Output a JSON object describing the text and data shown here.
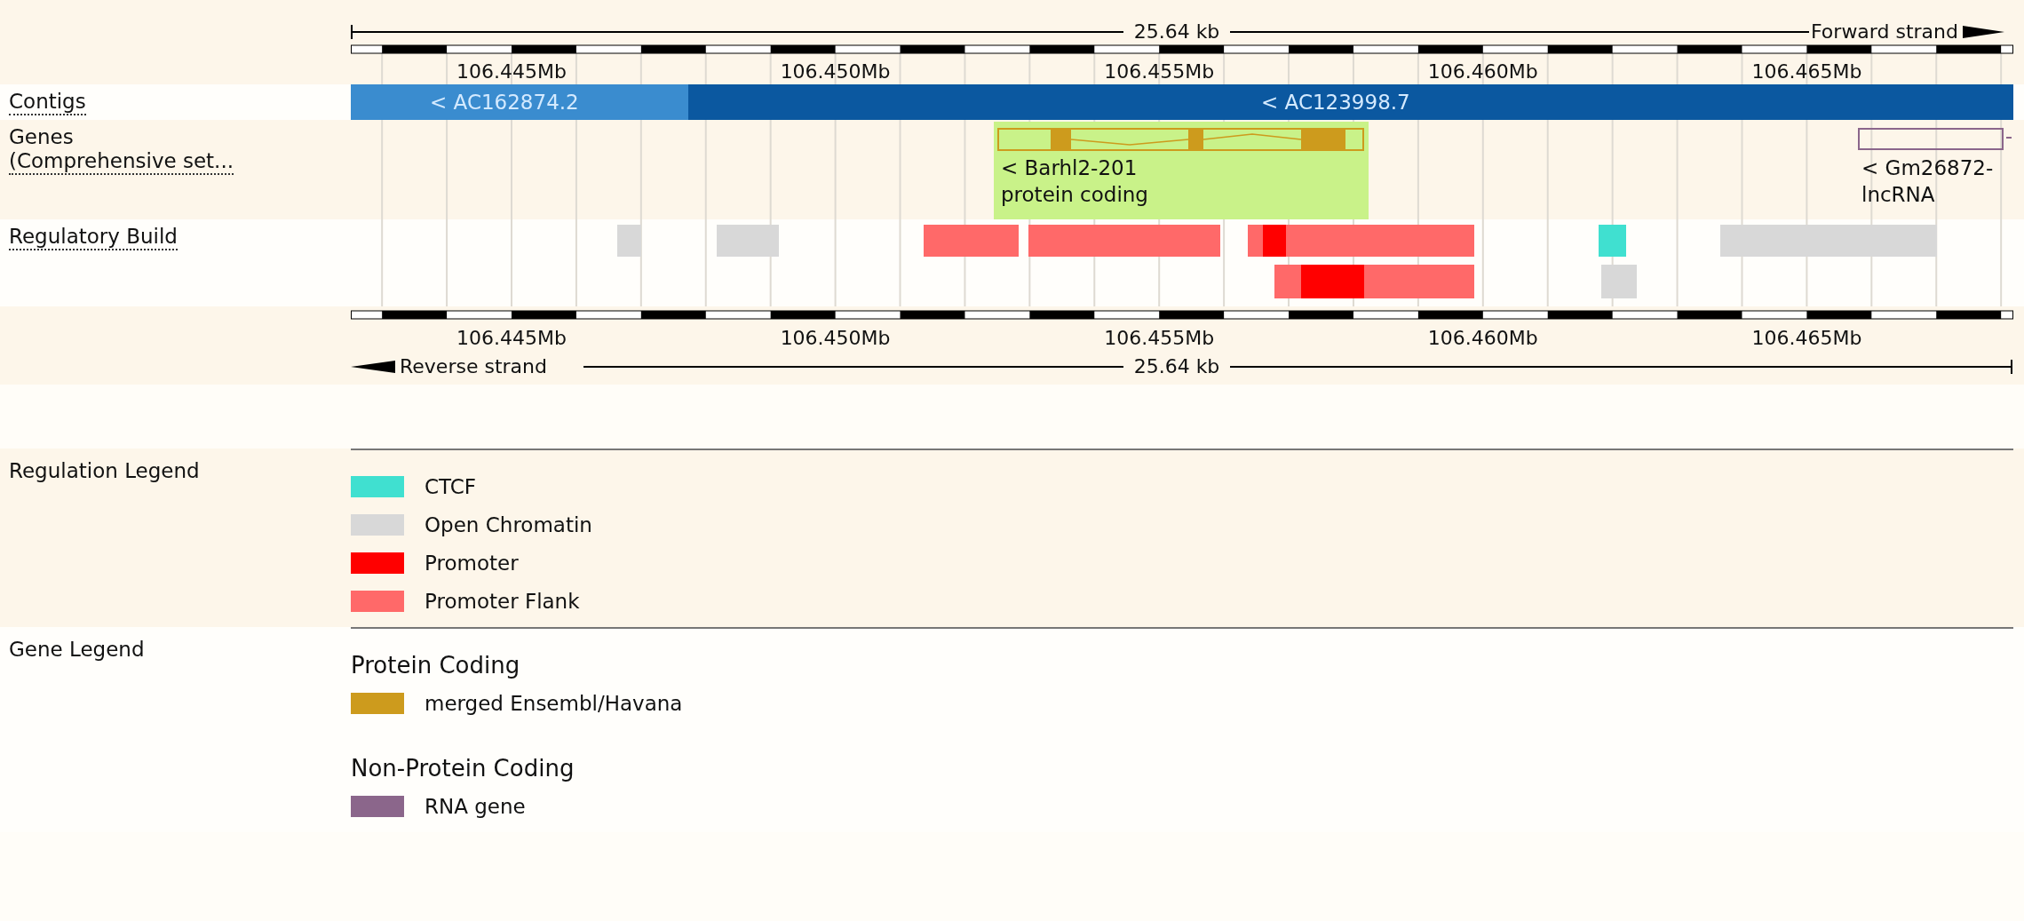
{
  "scale_top": {
    "length": "25.64 kb",
    "strand": "Forward strand"
  },
  "ticks_top": [
    "106.445Mb",
    "106.450Mb",
    "106.455Mb",
    "106.460Mb",
    "106.465Mb"
  ],
  "tracks": [
    {
      "kind": "contigs",
      "label": [
        "Contigs"
      ],
      "contigs": [
        {
          "name": "< AC162874.2",
          "color": "#3a8ccf"
        },
        {
          "name": "< AC123998.7",
          "color": "#0b58a0"
        }
      ]
    },
    {
      "kind": "genes",
      "label": [
        "Genes",
        "(Comprehensive set..."
      ],
      "genes": [
        {
          "name": "< Barhl2-201",
          "biotype": "protein coding",
          "selected": true
        },
        {
          "name": "< Gm26872-",
          "biotype": "lncRNA",
          "selected": false
        }
      ]
    },
    {
      "kind": "regulatory",
      "label": [
        "Regulatory Build"
      ]
    }
  ],
  "ticks_bottom": [
    "106.445Mb",
    "106.450Mb",
    "106.455Mb",
    "106.460Mb",
    "106.465Mb"
  ],
  "scale_bottom": {
    "length": "25.64 kb",
    "strand": "Reverse strand"
  },
  "regulation_legend": {
    "title": "Regulation Legend",
    "items": [
      {
        "label": "CTCF",
        "color": "#40e0d0"
      },
      {
        "label": "Open Chromatin",
        "color": "#d8d8d8"
      },
      {
        "label": "Promoter",
        "color": "#ff0000"
      },
      {
        "label": "Promoter Flank",
        "color": "#ff6969"
      }
    ]
  },
  "gene_legend": {
    "title": "Gene Legend",
    "groups": [
      {
        "title": "Protein Coding",
        "items": [
          {
            "label": "merged Ensembl/Havana",
            "color": "#cd9b1d"
          }
        ]
      },
      {
        "title": "Non-Protein Coding",
        "items": [
          {
            "label": "RNA gene",
            "color": "#8b668b"
          }
        ]
      }
    ]
  }
}
